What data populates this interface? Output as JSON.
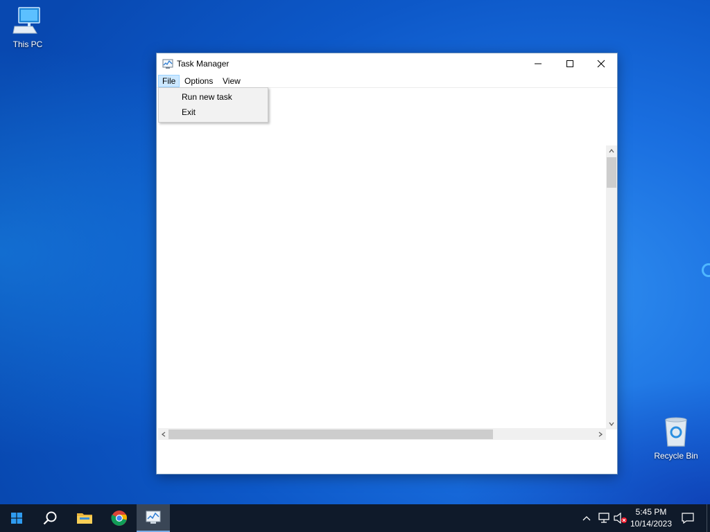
{
  "desktop": {
    "icons": [
      {
        "label": "This PC",
        "icon": "computer-icon"
      },
      {
        "label": "Recycle Bin",
        "icon": "recycle-bin-icon"
      }
    ]
  },
  "window": {
    "title": "Task Manager",
    "menu": [
      "File",
      "Options",
      "View"
    ],
    "file_menu_items": [
      "Run new task",
      "Exit"
    ]
  },
  "taskbar": {
    "apps": [
      "start-icon",
      "search-icon",
      "file-explorer-icon",
      "chrome-icon",
      "task-manager-icon"
    ],
    "clock": {
      "time": "5:45 PM",
      "date": "10/14/2023"
    }
  },
  "colors": {
    "menu_highlight": "#cce8ff",
    "taskbar": "#0f1a2a",
    "desktop_blue": "#1a6fe0"
  }
}
